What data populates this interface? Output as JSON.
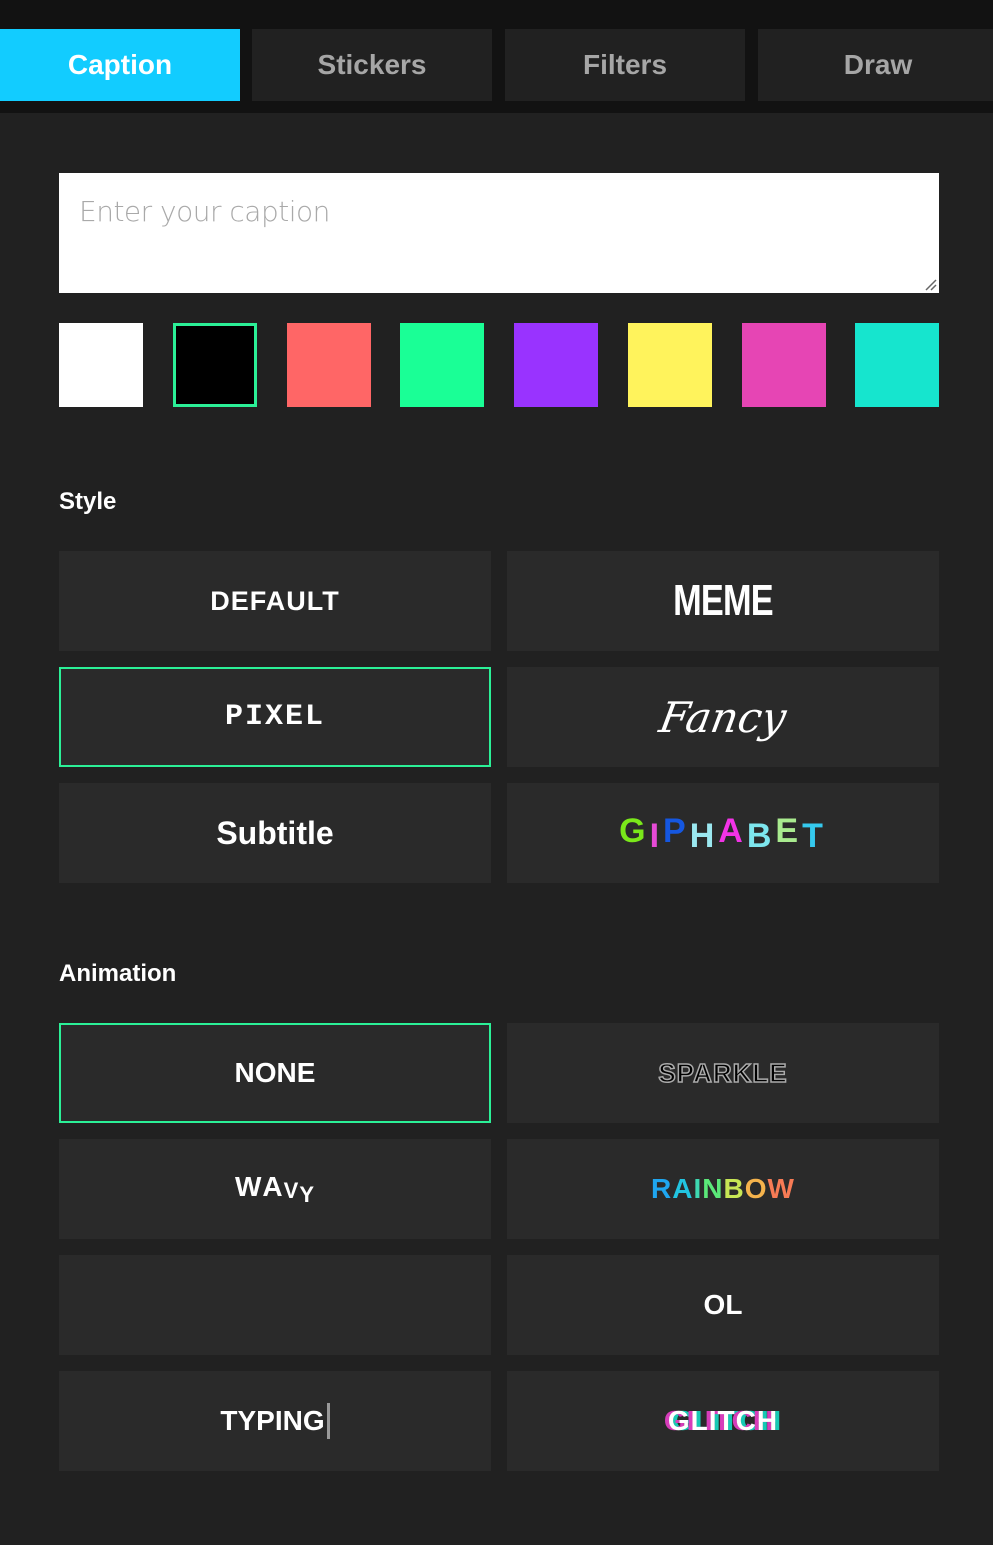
{
  "tabs": [
    {
      "label": "Caption",
      "active": true
    },
    {
      "label": "Stickers",
      "active": false
    },
    {
      "label": "Filters",
      "active": false
    },
    {
      "label": "Draw",
      "active": false
    }
  ],
  "caption_input": {
    "value": "",
    "placeholder": "Enter your caption"
  },
  "colors": {
    "accent": "#12ccff",
    "selection": "#2bf097",
    "swatches": [
      "#ffffff",
      "#000000",
      "#ff6666",
      "#1aff96",
      "#9933ff",
      "#fff35c",
      "#e645b4",
      "#16e5ce"
    ],
    "selected_index": 1
  },
  "style": {
    "label": "Style",
    "options": [
      {
        "label": "DEFAULT",
        "selected": false
      },
      {
        "label": "MEME",
        "selected": false
      },
      {
        "label": "PIXEL",
        "selected": true
      },
      {
        "label": "Fancy",
        "selected": false
      },
      {
        "label": "Subtitle",
        "selected": false
      },
      {
        "label": "GIPHABET",
        "selected": false
      }
    ],
    "giphabet_letters": [
      {
        "ch": "G",
        "color": "#7ae81a"
      },
      {
        "ch": "I",
        "color": "#e64bd6"
      },
      {
        "ch": "P",
        "color": "#1557e0"
      },
      {
        "ch": "H",
        "color": "#9be8f0"
      },
      {
        "ch": "A",
        "color": "#f233e6"
      },
      {
        "ch": "B",
        "color": "#7de6ee"
      },
      {
        "ch": "E",
        "color": "#a9eb8f"
      },
      {
        "ch": "T",
        "color": "#35c9ee"
      }
    ]
  },
  "animation": {
    "label": "Animation",
    "options": [
      {
        "label": "NONE",
        "selected": true
      },
      {
        "label": "SPARKLE",
        "selected": false
      },
      {
        "label": "WAVY",
        "selected": false
      },
      {
        "label": "RAINBOW",
        "selected": false
      },
      {
        "label": "",
        "selected": false
      },
      {
        "label": "OL",
        "selected": false
      },
      {
        "label": "TYPING",
        "selected": false
      },
      {
        "label": "GLITCH",
        "selected": false
      }
    ],
    "rainbow_colors": [
      "#1fa6f0",
      "#22c4e0",
      "#3ed8b0",
      "#5be879",
      "#c7e655",
      "#f5b34c",
      "#f77b55"
    ]
  }
}
